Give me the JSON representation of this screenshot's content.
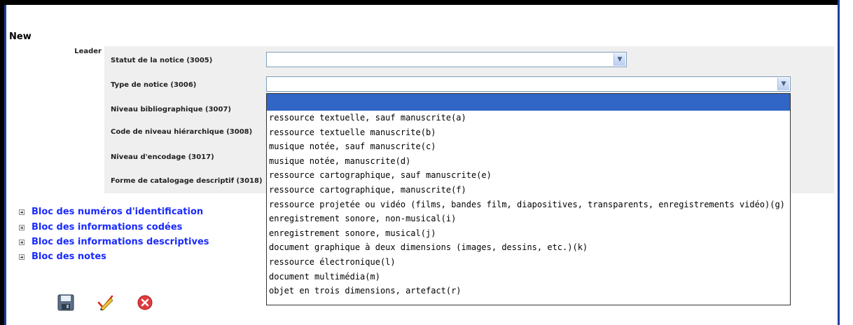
{
  "page": {
    "title": "New",
    "leader_label": "Leader"
  },
  "fields": [
    {
      "label": "Statut de la notice (3005)"
    },
    {
      "label": "Type de notice (3006)"
    },
    {
      "label": "Niveau bibliographique (3007)"
    },
    {
      "label": "Code de niveau hiérarchique (3008)"
    },
    {
      "label": "Niveau d'encodage (3017)"
    },
    {
      "label": "Forme de catalogage descriptif (3018)"
    }
  ],
  "dropdown": {
    "selected": "",
    "options": [
      "",
      "ressource textuelle, sauf manuscrite(a)",
      "ressource textuelle manuscrite(b)",
      "musique notée, sauf manuscrite(c)",
      "musique notée, manuscrite(d)",
      "ressource cartographique, sauf manuscrite(e)",
      "ressource cartographique, manuscrite(f)",
      "ressource projetée ou vidéo (films, bandes film, diapositives, transparents, enregistrements vidéo)(g)",
      "enregistrement sonore, non-musical(i)",
      "enregistrement sonore, musical(j)",
      "document graphique à deux dimensions (images, dessins, etc.)(k)",
      "ressource électronique(l)",
      "document multimédia(m)",
      "objet en trois dimensions, artefact(r)"
    ]
  },
  "blocs": [
    {
      "label": "Bloc des numéros d'identification"
    },
    {
      "label": "Bloc des informations codées"
    },
    {
      "label": "Bloc des informations descriptives"
    },
    {
      "label": "Bloc des notes"
    }
  ],
  "toolbar": {
    "icons": [
      "save-icon",
      "validate-icon",
      "cancel-icon"
    ]
  },
  "colors": {
    "link": "#1a2bff",
    "selection": "#3165c6",
    "frame": "#1e3f9a"
  }
}
